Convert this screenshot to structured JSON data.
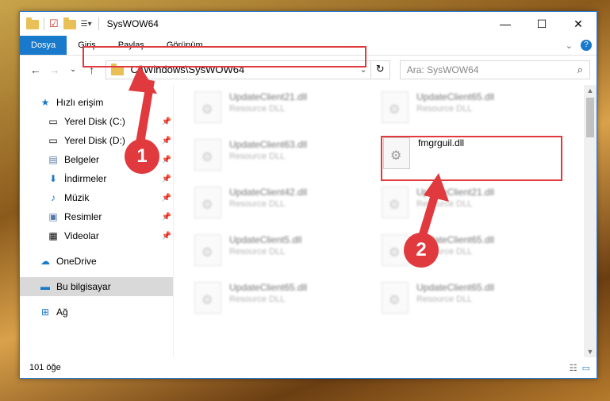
{
  "window": {
    "title": "SysWOW64"
  },
  "titlebar": {
    "minimize": "—",
    "maximize": "☐",
    "close": "✕"
  },
  "ribbon": {
    "tabs": [
      "Dosya",
      "Giriş",
      "Paylaş",
      "Görünüm"
    ]
  },
  "address": {
    "path": "C:\\Windows\\SysWOW64"
  },
  "search": {
    "placeholder": "Ara: SysWOW64"
  },
  "sidebar": {
    "quick_access": "Hızlı erişim",
    "items": [
      {
        "label": "Yerel Disk (C:)",
        "icon": "drive-icon"
      },
      {
        "label": "Yerel Disk (D:)",
        "icon": "drive-icon"
      },
      {
        "label": "Belgeler",
        "icon": "documents-icon"
      },
      {
        "label": "İndirmeler",
        "icon": "download-icon"
      },
      {
        "label": "Müzik",
        "icon": "music-icon"
      },
      {
        "label": "Resimler",
        "icon": "pictures-icon"
      },
      {
        "label": "Videolar",
        "icon": "video-icon"
      }
    ],
    "onedrive": "OneDrive",
    "this_pc": "Bu bilgisayar",
    "network": "Ağ"
  },
  "files": [
    {
      "name": "UpdateClient21.dll",
      "type": "Resource DLL"
    },
    {
      "name": "UpdateClient65.dll",
      "type": "Resource DLL"
    },
    {
      "name": "UpdateClient63.dll",
      "type": "Resource DLL"
    },
    {
      "name": "fmgrguil.dll",
      "type": ""
    },
    {
      "name": "UpdateClient42.dll",
      "type": "Resource DLL"
    },
    {
      "name": "UpdateClient21.dll",
      "type": "Resource DLL"
    },
    {
      "name": "UpdateClient5.dll",
      "type": "Resource DLL"
    },
    {
      "name": "UpdateClient65.dll",
      "type": "Resource DLL"
    },
    {
      "name": "UpdateClient65.dll",
      "type": "Resource DLL"
    },
    {
      "name": "UpdateClient65.dll",
      "type": "Resource DLL"
    }
  ],
  "status": {
    "count": "101 öğe"
  },
  "callouts": {
    "step1": "1",
    "step2": "2",
    "color": "#e0393e"
  }
}
